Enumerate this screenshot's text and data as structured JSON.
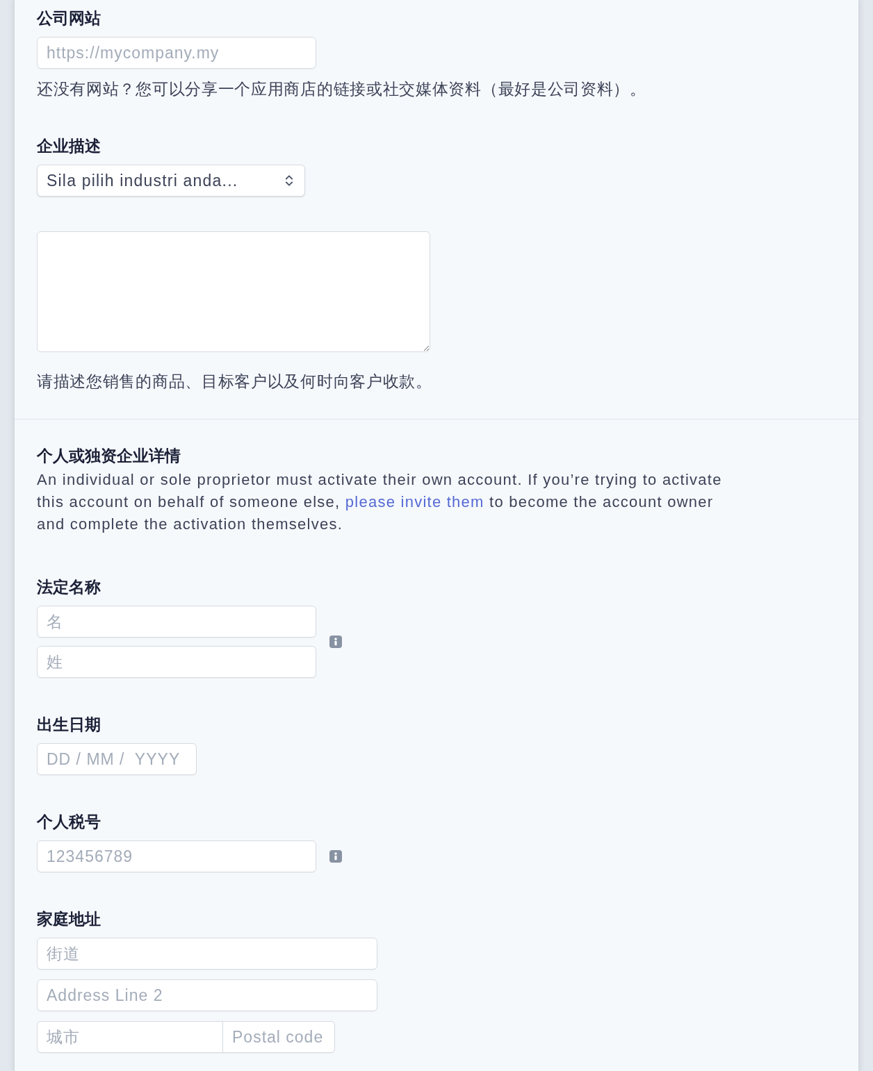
{
  "business": {
    "fields": [
      {
        "kind": "website",
        "label": "公司网站",
        "controls": [
          {
            "kind": "input",
            "placeholder": "https://mycompany.my"
          }
        ],
        "help": "还没有网站？您可以分享一个应用商店的链接或社交媒体资料（最好是公司资料）。"
      },
      {
        "kind": "description",
        "label": "企业描述",
        "controls": [
          {
            "kind": "select",
            "value": "Sila pilih industri anda..."
          },
          {
            "kind": "textarea"
          }
        ],
        "help": "请描述您销售的商品、目标客户以及何时向客户收款。"
      }
    ]
  },
  "person": {
    "heading": "个人或独资企业详情",
    "intro": {
      "text_before": "An individual or sole proprietor must activate their own account. If you’re trying to activate this account on behalf of someone else,",
      "link": "please invite them",
      "text_after": "to become the account owner and complete the activation themselves."
    },
    "fields": [
      {
        "kind": "name",
        "label": "法定名称",
        "info": true,
        "rows": [
          [
            {
              "kind": "input",
              "placeholder": "名"
            }
          ],
          [
            {
              "kind": "input",
              "placeholder": "姓"
            }
          ]
        ]
      },
      {
        "kind": "date",
        "label": "出生日期",
        "info": false,
        "rows": [
          [
            {
              "kind": "input",
              "placeholder": "DD / MM /  YYYY"
            }
          ]
        ]
      },
      {
        "kind": "tax_id",
        "label": "个人税号",
        "info": true,
        "rows": [
          [
            {
              "kind": "input",
              "placeholder": "123456789"
            }
          ]
        ]
      },
      {
        "kind": "address",
        "label": "家庭地址",
        "info": false,
        "rows": [
          [
            {
              "kind": "input",
              "placeholder": "街道"
            }
          ],
          [
            {
              "kind": "input",
              "placeholder": "Address Line 2"
            }
          ],
          [
            {
              "kind": "city",
              "placeholder": "城市"
            },
            {
              "kind": "postal",
              "placeholder": "Postal code"
            }
          ]
        ]
      }
    ]
  }
}
